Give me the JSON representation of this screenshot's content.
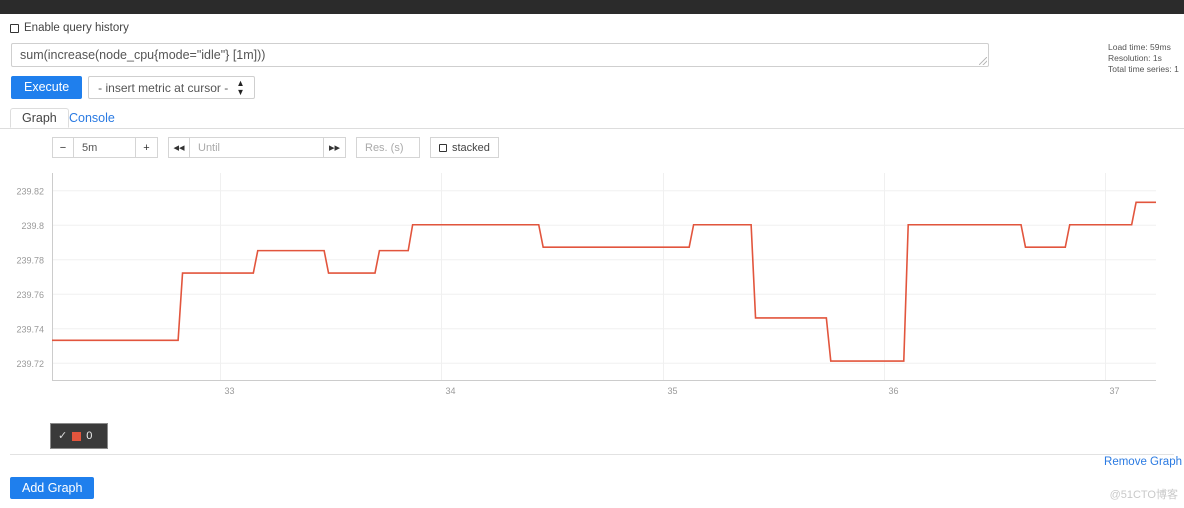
{
  "query_form": {
    "history_checkbox_label": "Enable query history",
    "query_value": "sum(increase(node_cpu{mode=\"idle\"} [1m]))",
    "execute_label": "Execute",
    "metric_select_value": "- insert metric at cursor -"
  },
  "stats": {
    "load_time": "Load time: 59ms",
    "resolution": "Resolution: 1s",
    "total_series": "Total time series: 1"
  },
  "tabs": [
    {
      "label": "Graph",
      "active": true
    },
    {
      "label": "Console",
      "active": false
    }
  ],
  "controls": {
    "minus_label": "−",
    "range_value": "5m",
    "plus_label": "+",
    "step_back_label": "◂◂",
    "until_placeholder": "Until",
    "step_fwd_label": "▸▸",
    "res_placeholder": "Res. (s)",
    "stacked_label": "stacked"
  },
  "legend": {
    "check": "✓",
    "label": "0",
    "color": "#e2553d"
  },
  "footer": {
    "remove_graph_label": "Remove Graph",
    "add_graph_label": "Add Graph",
    "watermark": "@51CTO博客"
  },
  "chart_data": {
    "type": "line",
    "title": "",
    "xlabel": "",
    "ylabel": "",
    "line_color": "#e2553d",
    "grid": true,
    "legend_position": "bottom-left",
    "step_interpolation": true,
    "ylim": [
      239.71,
      239.83
    ],
    "yticks": [
      239.82,
      239.8,
      239.78,
      239.76,
      239.74,
      239.72
    ],
    "ytick_labels": [
      "239.82",
      "239.8",
      "239.78",
      "239.76",
      "239.74",
      "239.72"
    ],
    "xticks": [
      33,
      34,
      35,
      36,
      37
    ],
    "xtick_labels": [
      "33",
      "34",
      "35",
      "36",
      "37"
    ],
    "xlim": [
      32.24,
      37.23
    ],
    "series": [
      {
        "name": "0",
        "x": [
          32.24,
          32.81,
          32.83,
          33.15,
          33.17,
          33.47,
          33.49,
          33.7,
          33.72,
          33.85,
          33.87,
          34.44,
          34.46,
          35.12,
          35.14,
          35.4,
          35.42,
          35.52,
          35.54,
          35.74,
          35.76,
          36.09,
          36.11,
          36.62,
          36.64,
          36.82,
          36.84,
          37.12,
          37.14,
          37.23
        ],
        "y": [
          239.733,
          239.733,
          239.772,
          239.772,
          239.785,
          239.785,
          239.772,
          239.772,
          239.785,
          239.785,
          239.8,
          239.8,
          239.787,
          239.787,
          239.8,
          239.8,
          239.746,
          239.746,
          239.746,
          239.746,
          239.721,
          239.721,
          239.8,
          239.8,
          239.787,
          239.787,
          239.8,
          239.8,
          239.813,
          239.813
        ]
      }
    ]
  }
}
